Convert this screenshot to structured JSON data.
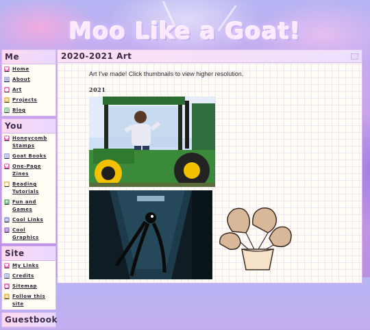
{
  "header": {
    "site_title": "Moo Like a Goat!"
  },
  "sidebar": {
    "sections": [
      {
        "title": "Me",
        "items": [
          {
            "label": "Home",
            "icon": "heart-icon",
            "color": "#e86fb7"
          },
          {
            "label": "About",
            "icon": "goat-icon",
            "color": "#9aa4d8"
          },
          {
            "label": "Art",
            "icon": "palette-icon",
            "color": "#e86fb7"
          },
          {
            "label": "Projects",
            "icon": "star-icon",
            "color": "#f0c05a"
          },
          {
            "label": "Blog",
            "icon": "book-icon",
            "color": "#7fbf8c"
          }
        ]
      },
      {
        "title": "You",
        "items": [
          {
            "label": "Honeycomb Stamps",
            "icon": "heart-icon",
            "color": "#e86fb7"
          },
          {
            "label": "Goat Books",
            "icon": "book-icon",
            "color": "#9aa4d8"
          },
          {
            "label": "One-Page Zines",
            "icon": "heart-icon",
            "color": "#e86fb7"
          },
          {
            "label": "Beading Tutorials",
            "icon": "bead-icon",
            "color": "#f0c05a"
          },
          {
            "label": "Fun and Games",
            "icon": "game-icon",
            "color": "#7fbf8c"
          },
          {
            "label": "Cool Links",
            "icon": "link-icon",
            "color": "#9aa4d8"
          },
          {
            "label": "Cool Graphics",
            "icon": "sparkle-icon",
            "color": "#b78ae0"
          }
        ]
      },
      {
        "title": "Site",
        "items": [
          {
            "label": "My Links",
            "icon": "heart-icon",
            "color": "#e86fb7"
          },
          {
            "label": "Credits",
            "icon": "note-icon",
            "color": "#9aa4d8"
          },
          {
            "label": "Sitemap",
            "icon": "map-icon",
            "color": "#e86fb7"
          },
          {
            "label": "Follow this site",
            "icon": "follow-icon",
            "color": "#f0c05a"
          }
        ]
      },
      {
        "title": "Guestbook",
        "items": []
      }
    ]
  },
  "main": {
    "page_title": "2020-2021 Art",
    "intro": "Art I've made! Click thumbnails to view higher resolution.",
    "year_heading": "2021",
    "artworks": [
      {
        "name": "tractor-portrait"
      },
      {
        "name": "dark-hallway-creature"
      },
      {
        "name": "monstera-plant"
      }
    ]
  }
}
